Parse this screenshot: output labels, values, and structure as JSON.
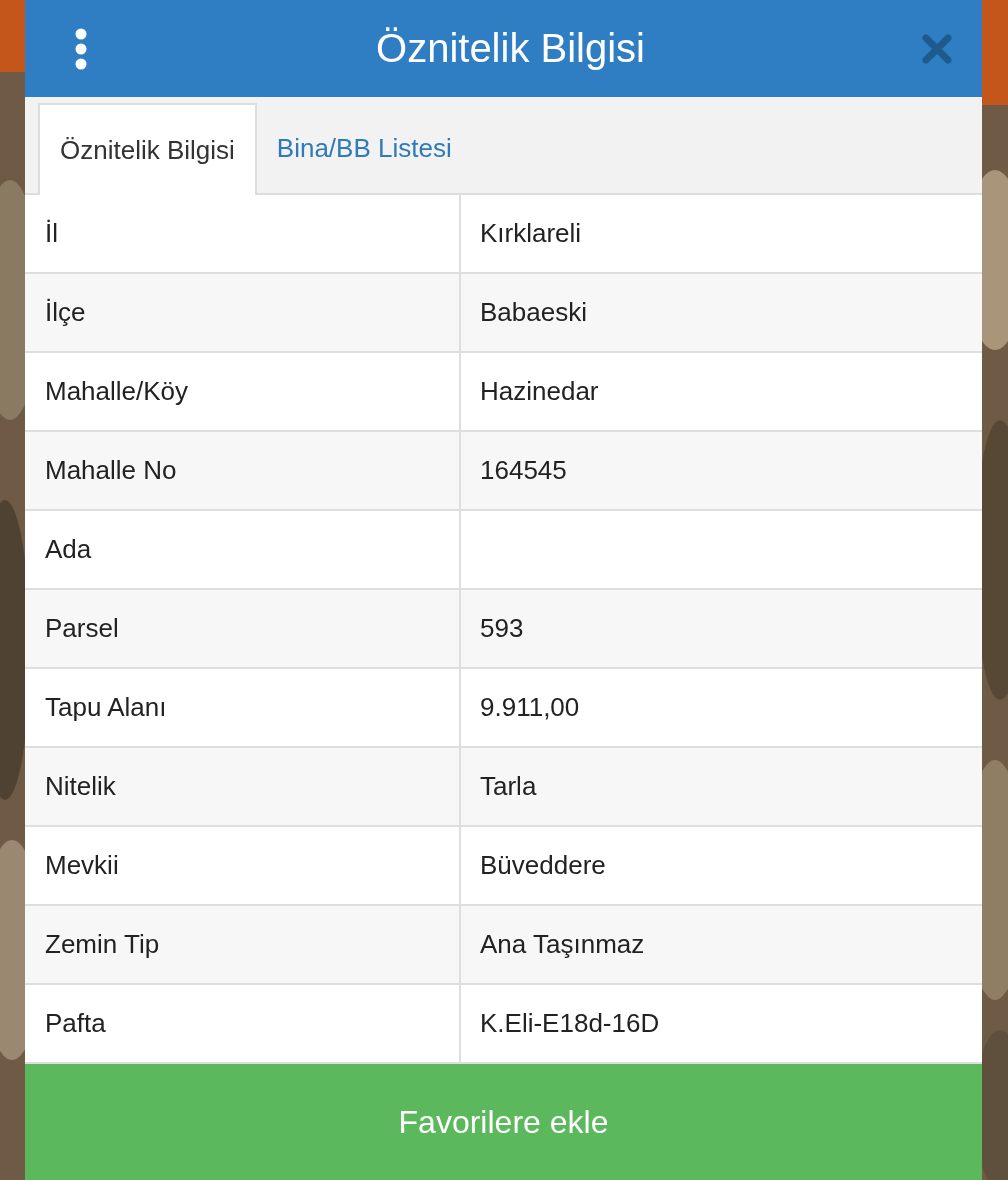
{
  "dialog": {
    "title": "Öznitelik Bilgisi"
  },
  "tabs": [
    {
      "label": "Öznitelik Bilgisi",
      "selected": true
    },
    {
      "label": "Bina/BB Listesi",
      "selected": false
    }
  ],
  "rows": [
    {
      "label": "İl",
      "value": "Kırklareli"
    },
    {
      "label": "İlçe",
      "value": "Babaeski"
    },
    {
      "label": "Mahalle/Köy",
      "value": "Hazinedar"
    },
    {
      "label": "Mahalle No",
      "value": "164545"
    },
    {
      "label": "Ada"
    },
    {
      "label": "Parsel",
      "value": "593"
    },
    {
      "label": "Tapu Alanı",
      "value": "9.911,00"
    },
    {
      "label": "Nitelik",
      "value": "Tarla"
    },
    {
      "label": "Mevkii",
      "value": "Büveddere"
    },
    {
      "label": "Zemin Tip",
      "value": "Ana Taşınmaz"
    },
    {
      "label": "Pafta",
      "value": "K.Eli-E18d-16D"
    }
  ],
  "action_button": {
    "label": "Favorilere ekle"
  }
}
